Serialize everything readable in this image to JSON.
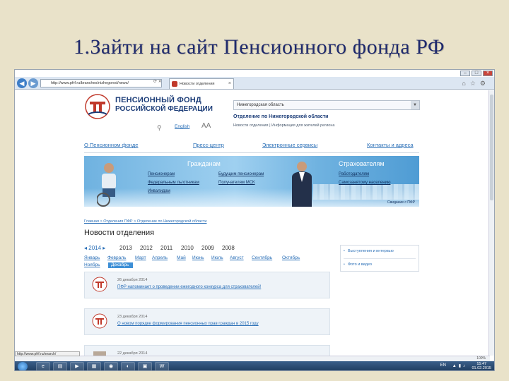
{
  "slide_title": "1.Зайти на сайт Пенсионного фонда РФ",
  "browser": {
    "address": "http://www.pfrf.ru/branches/nizhegorod/news/",
    "tab_title": "Новости отделения",
    "status_url": "http://www.pfrf.ru/search/"
  },
  "site": {
    "logo_line1": "ПЕНСИОННЫЙ ФОНД",
    "logo_line2": "РОССИЙСКОЙ ФЕДЕРАЦИИ",
    "lang": "English",
    "font_size": "AA",
    "region": "Нижегородская область",
    "dept_name": "Отделение по Нижегородской области",
    "dept_links": "Новости отделения  |  Информация для жителей региона",
    "nav": [
      "О Пенсионном фонде",
      "Пресс-центр",
      "Электронные сервисы",
      "Контакты и адреса"
    ]
  },
  "banner": {
    "citizens": "Гражданам",
    "insurers": "Страхователям",
    "links_left": [
      "Пенсионерам",
      "Федеральным льготникам",
      "Инвалидам"
    ],
    "links_mid": [
      "Будущим пенсионерам",
      "Получателям МСК"
    ],
    "links_right": [
      "Работодателям",
      "Самозанятому населению"
    ],
    "footer": "Свидание с ПФР"
  },
  "breadcrumb": "Главная > Отделения ПФР > Отделение по Нижегородской области",
  "news": {
    "heading": "Новости отделения",
    "current_year": "◂ 2014 ▸",
    "years": [
      "2013",
      "2012",
      "2011",
      "2010",
      "2009",
      "2008"
    ],
    "months_row1": [
      "Январь",
      "Февраль",
      "Март",
      "Апрель",
      "Май",
      "Июнь",
      "Июль",
      "Август",
      "Сентябрь",
      "Октябрь"
    ],
    "months_row2": [
      "Ноябрь",
      "Декабрь"
    ],
    "sidebar": [
      "Выступления и интервью",
      "Фото и видео"
    ],
    "items": [
      {
        "date": "26 декабря 2014",
        "title": "ПФР напоминает о проведении ежегодного конкурса для страхователей!"
      },
      {
        "date": "23 декабря 2014",
        "title": "О новом порядке формирования пенсионных прав граждан в 2015 году"
      },
      {
        "date": "22 декабря 2014",
        "title": ""
      }
    ]
  },
  "taskbar": {
    "lang": "EN",
    "time": "15:47",
    "date": "01.02.2015",
    "zoom": "100%"
  }
}
